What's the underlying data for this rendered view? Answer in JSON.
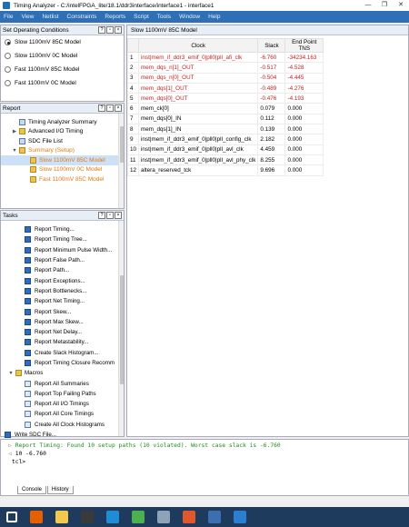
{
  "window": {
    "title": "Timing Analyzer - C:/intelFPGA_lite/18.1/ddr3interface/interface1 - interface1",
    "controls": [
      "—",
      "❐",
      "✕"
    ]
  },
  "menu": [
    "File",
    "View",
    "Netlist",
    "Constraints",
    "Reports",
    "Script",
    "Tools",
    "Window",
    "Help"
  ],
  "operating_conditions": {
    "header": "Set Operating Conditions",
    "options": [
      {
        "label": "Slow 1100mV 85C Model",
        "selected": true
      },
      {
        "label": "Slow 1100mV 0C Model",
        "selected": false
      },
      {
        "label": "Fast 1100mV 85C Model",
        "selected": false
      },
      {
        "label": "Fast 1100mV 0C Model",
        "selected": false
      }
    ]
  },
  "report": {
    "header": "Report",
    "items": [
      {
        "label": "Timing Analyzer Summary",
        "indent": 1,
        "icon": "table",
        "arrow": ""
      },
      {
        "label": "Advanced I/O Timing",
        "indent": 1,
        "icon": "folder",
        "arrow": "▶"
      },
      {
        "label": "SDC File List",
        "indent": 1,
        "icon": "table",
        "arrow": ""
      },
      {
        "label": "Summary (Setup)",
        "indent": 1,
        "icon": "folder",
        "arrow": "▼",
        "color": "orange"
      },
      {
        "label": "Slow 1100mV 85C Model",
        "indent": 2,
        "icon": "folder",
        "arrow": "",
        "color": "orange",
        "selected": true
      },
      {
        "label": "Slow 1100mV 0C Model",
        "indent": 2,
        "icon": "folder",
        "arrow": "",
        "color": "orange"
      },
      {
        "label": "Fast 1100mV 85C Model",
        "indent": 2,
        "icon": "folder",
        "arrow": "",
        "color": "orange"
      }
    ]
  },
  "tasks": {
    "header": "Tasks",
    "items": [
      "Report Timing...",
      "Report Timing Tree...",
      "Report Minimum Pulse Width...",
      "Report False Path...",
      "Report Path...",
      "Report Exceptions...",
      "Report Bottlenecks...",
      "Report Net Timing...",
      "Report Skew...",
      "Report Max Skew...",
      "Report Net Delay...",
      "Report Metastability...",
      "Create Slack Histogram...",
      "Report Timing Closure Recomm"
    ],
    "macros_label": "Macros",
    "macros": [
      "Report All Summaries",
      "Report Top Failing Paths",
      "Report All I/O Timings",
      "Report All Core Timings",
      "Create All Clock Histograms"
    ],
    "write_sdc": "Write SDC File..."
  },
  "main": {
    "tab_title": "Slow 1100mV 85C Model",
    "columns": [
      "Clock",
      "Slack",
      "End Point TNS"
    ],
    "rows": [
      {
        "idx": "1",
        "clock": "inst|mem_if_ddr3_emif_0|pll0|pll_afi_clk",
        "slack": "-6.760",
        "tns": "-34234.163",
        "violated": true
      },
      {
        "idx": "2",
        "clock": "mem_dqs_n[1]_OUT",
        "slack": "-0.517",
        "tns": "-4.528",
        "violated": true
      },
      {
        "idx": "3",
        "clock": "mem_dqs_n[0]_OUT",
        "slack": "-0.504",
        "tns": "-4.445",
        "violated": true
      },
      {
        "idx": "4",
        "clock": "mem_dqs[1]_OUT",
        "slack": "-0.489",
        "tns": "-4.276",
        "violated": true
      },
      {
        "idx": "5",
        "clock": "mem_dqs[0]_OUT",
        "slack": "-0.476",
        "tns": "-4.193",
        "violated": true
      },
      {
        "idx": "6",
        "clock": "mem_ck[0]",
        "slack": "0.079",
        "tns": "0.000",
        "violated": false
      },
      {
        "idx": "7",
        "clock": "mem_dqs[0]_IN",
        "slack": "0.112",
        "tns": "0.000",
        "violated": false
      },
      {
        "idx": "8",
        "clock": "mem_dqs[1]_IN",
        "slack": "0.139",
        "tns": "0.000",
        "violated": false
      },
      {
        "idx": "9",
        "clock": "inst|mem_if_ddr3_emif_0|pll0|pll_config_clk",
        "slack": "2.182",
        "tns": "0.000",
        "violated": false
      },
      {
        "idx": "10",
        "clock": "inst|mem_if_ddr3_emif_0|pll0|pll_avl_clk",
        "slack": "4.459",
        "tns": "0.000",
        "violated": false
      },
      {
        "idx": "11",
        "clock": "inst|mem_if_ddr3_emif_0|pll0|pll_avl_phy_clk",
        "slack": "8.255",
        "tns": "0.000",
        "violated": false
      },
      {
        "idx": "12",
        "clock": "altera_reserved_tck",
        "slack": "9.696",
        "tns": "0.000",
        "violated": false
      }
    ]
  },
  "console": {
    "lines": [
      {
        "prefix": "▷",
        "text": "Report Timing: Found 10 setup paths (10 violated).  Worst case slack is -6.760",
        "color": "#1e8a1e"
      },
      {
        "prefix": "◁",
        "text": "10 -6.760",
        "color": "#000000"
      },
      {
        "prefix": "",
        "text": "tcl>",
        "color": "#000000"
      }
    ],
    "tabs": [
      "Console",
      "History"
    ]
  },
  "colors": {
    "menubar": "#2f6fb5",
    "violated_text": "#c42222",
    "orange_text": "#e07a10",
    "taskbar": "#1e3a5c"
  },
  "taskbar_icons": [
    "windows-start-icon",
    "firefox-icon",
    "file-explorer-icon",
    "media-player-icon",
    "ie-icon",
    "chrome-icon",
    "tool-icon",
    "matlab-icon",
    "quartus-icon",
    "app-icon"
  ]
}
